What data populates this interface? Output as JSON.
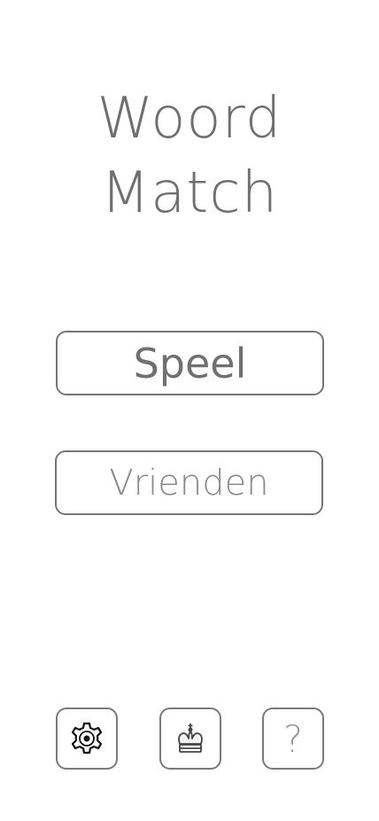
{
  "app": {
    "title_line_1": "Woord",
    "title_line_2": "Match"
  },
  "menu": {
    "play_label": "Speel",
    "friends_label": "Vrienden"
  },
  "bottom_bar": {
    "items": [
      {
        "icon": "gear-icon"
      },
      {
        "icon": "crown-icon"
      },
      {
        "icon": "question-mark-icon",
        "glyph": "?"
      }
    ]
  },
  "colors": {
    "text": "#777777",
    "border": "#767676",
    "background": "#ffffff"
  }
}
